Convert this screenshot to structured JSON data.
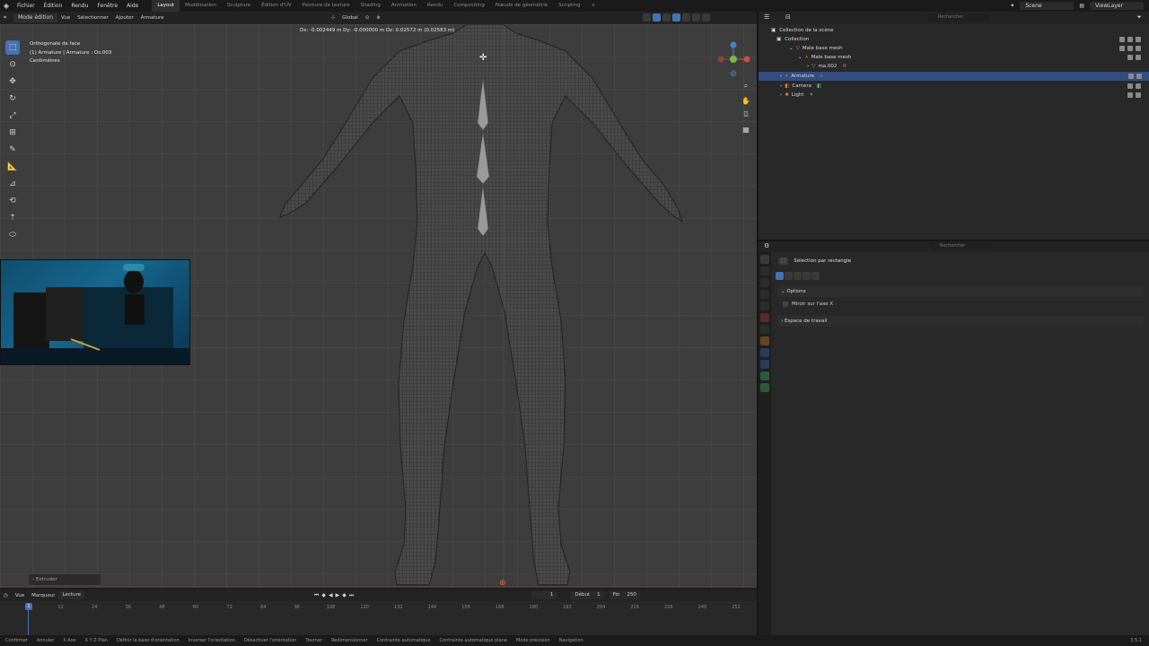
{
  "menu": [
    "Fichier",
    "Édition",
    "Rendu",
    "Fenêtre",
    "Aide"
  ],
  "workspaces": [
    "Layout",
    "Modélisation",
    "Sculpture",
    "Édition d'UV",
    "Peinture de texture",
    "Shading",
    "Animation",
    "Rendu",
    "Compositing",
    "Nœuds de géométrie",
    "Scripting"
  ],
  "active_workspace": "Layout",
  "scene": "Scene",
  "view_layer": "ViewLayer",
  "viewport": {
    "mode": "Mode édition",
    "menus": [
      "Vue",
      "Sélectionner",
      "Ajouter",
      "Armature"
    ],
    "orientation": "Global",
    "view_name": "Orthogonale de face",
    "object_info": "(1) Armature | Armature : Os.003",
    "units": "Centimètres",
    "transform_status": "Dx: -0.002449 m  Dy: -0.000000 m  Dz: 0.02572 m (0.02583 m)",
    "operator_panel": "Extruder"
  },
  "outliner": {
    "search_placeholder": "Rechercher",
    "items": [
      {
        "label": "Collection de la scène"
      },
      {
        "label": "Collection"
      },
      {
        "label": "Male base mesh"
      },
      {
        "label": "Male base mesh"
      },
      {
        "label": "ma.002"
      },
      {
        "label": "Armature"
      },
      {
        "label": "Camera"
      },
      {
        "label": "Light"
      }
    ]
  },
  "properties": {
    "search_placeholder": "Rechercher",
    "tool_name": "Sélection par rectangle",
    "sections": [
      "Options",
      "Miroir sur l'axe X",
      "Espace de travail"
    ]
  },
  "timeline": {
    "menus": [
      "Vue",
      "Marqueur"
    ],
    "playback": "Lecture",
    "current_frame": "1",
    "start_label": "Début",
    "start": "1",
    "end_label": "Fin",
    "end": "250",
    "frames": [
      "1",
      "12",
      "24",
      "36",
      "48",
      "60",
      "72",
      "84",
      "96",
      "108",
      "120",
      "132",
      "144",
      "156",
      "168",
      "180",
      "192",
      "204",
      "216",
      "228",
      "240",
      "252"
    ]
  },
  "statusbar": [
    "Confirmer",
    "Annuler",
    "X Axe",
    "X Y Z Plan",
    "Définir la base d'orientation",
    "Inverser l'orientation",
    "Désactiver l'orientation",
    "Tourner",
    "Redimensionner",
    "Contrainte automatique",
    "Contrainte automatique plane",
    "Mode précision",
    "Navigation"
  ],
  "version": "3.5.1",
  "colors": {
    "accent": "#4772b3",
    "selection": "#334d80",
    "viewport_bg": "#3d3d3d"
  }
}
